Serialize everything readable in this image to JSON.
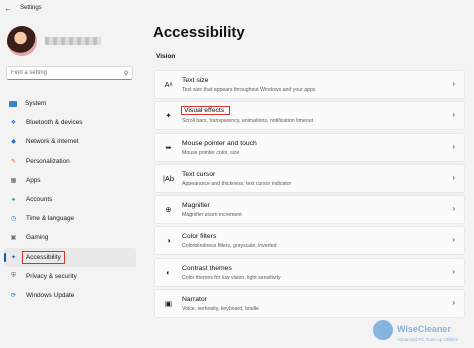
{
  "window": {
    "title": "Settings"
  },
  "sidebar": {
    "search_placeholder": "Find a setting",
    "items": [
      {
        "label": "System",
        "icon": "system-icon"
      },
      {
        "label": "Bluetooth & devices",
        "icon": "bluetooth-icon"
      },
      {
        "label": "Network & internet",
        "icon": "network-icon"
      },
      {
        "label": "Personalization",
        "icon": "brush-icon"
      },
      {
        "label": "Apps",
        "icon": "apps-icon"
      },
      {
        "label": "Accounts",
        "icon": "person-icon"
      },
      {
        "label": "Time & language",
        "icon": "globe-clock-icon"
      },
      {
        "label": "Gaming",
        "icon": "gamepad-icon"
      },
      {
        "label": "Accessibility",
        "icon": "accessibility-icon",
        "selected": true
      },
      {
        "label": "Privacy & security",
        "icon": "shield-icon"
      },
      {
        "label": "Windows Update",
        "icon": "update-icon"
      }
    ]
  },
  "main": {
    "title": "Accessibility",
    "section": "Vision",
    "cards": [
      {
        "title": "Text size",
        "subtitle": "Text size that appears throughout Windows and your apps",
        "icon": "text-size-icon"
      },
      {
        "title": "Visual effects",
        "subtitle": "Scroll bars, transparency, animations, notification timeout",
        "icon": "sparkle-icon",
        "highlighted": true
      },
      {
        "title": "Mouse pointer and touch",
        "subtitle": "Mouse pointer color, size",
        "icon": "mouse-pointer-icon"
      },
      {
        "title": "Text cursor",
        "subtitle": "Appearance and thickness, text cursor indicator",
        "icon": "text-cursor-icon"
      },
      {
        "title": "Magnifier",
        "subtitle": "Magnifier zoom increment",
        "icon": "magnifier-icon"
      },
      {
        "title": "Color filters",
        "subtitle": "Colorblindness filters, grayscale, inverted",
        "icon": "color-filters-icon"
      },
      {
        "title": "Contrast themes",
        "subtitle": "Color themes for low vision, light sensitivity",
        "icon": "contrast-icon"
      },
      {
        "title": "Narrator",
        "subtitle": "Voice, verbosity, keyboard, braille",
        "icon": "narrator-icon"
      }
    ]
  },
  "watermark": {
    "text": "WiseCleaner",
    "sub": "Advanced PC Tune-up Utilities"
  },
  "colors": {
    "accent": "#005fb8",
    "highlight_border": "#d9342b",
    "background": "#f3f3f3"
  }
}
